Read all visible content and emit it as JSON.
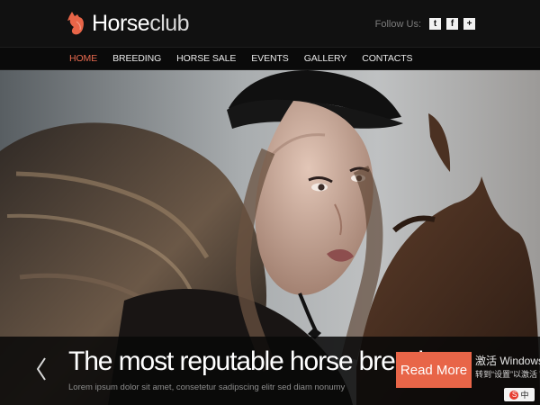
{
  "header": {
    "logo_horse": "Horse",
    "logo_club": "club",
    "follow_label": "Follow Us:",
    "social_items": [
      "twitter-icon",
      "facebook-icon",
      "plus-icon"
    ]
  },
  "nav": {
    "items": [
      {
        "label": "HOME",
        "active": true
      },
      {
        "label": "BREEDING",
        "active": false
      },
      {
        "label": "HORSE SALE",
        "active": false
      },
      {
        "label": "EVENTS",
        "active": false
      },
      {
        "label": "GALLERY",
        "active": false
      },
      {
        "label": "CONTACTS",
        "active": false
      }
    ]
  },
  "hero": {
    "headline": "The most reputable horse breeder",
    "subline": "Lorem ipsum dolor sit amet, consetetur sadipscing elitr sed diam nonumy",
    "cta_label": "Read More",
    "overlay_text_1": "激活 Windows",
    "overlay_text_2": "转到“设置”以激活 W"
  },
  "colors": {
    "accent": "#e8654a",
    "header_bg": "#111111"
  },
  "ime": {
    "label": "中"
  }
}
